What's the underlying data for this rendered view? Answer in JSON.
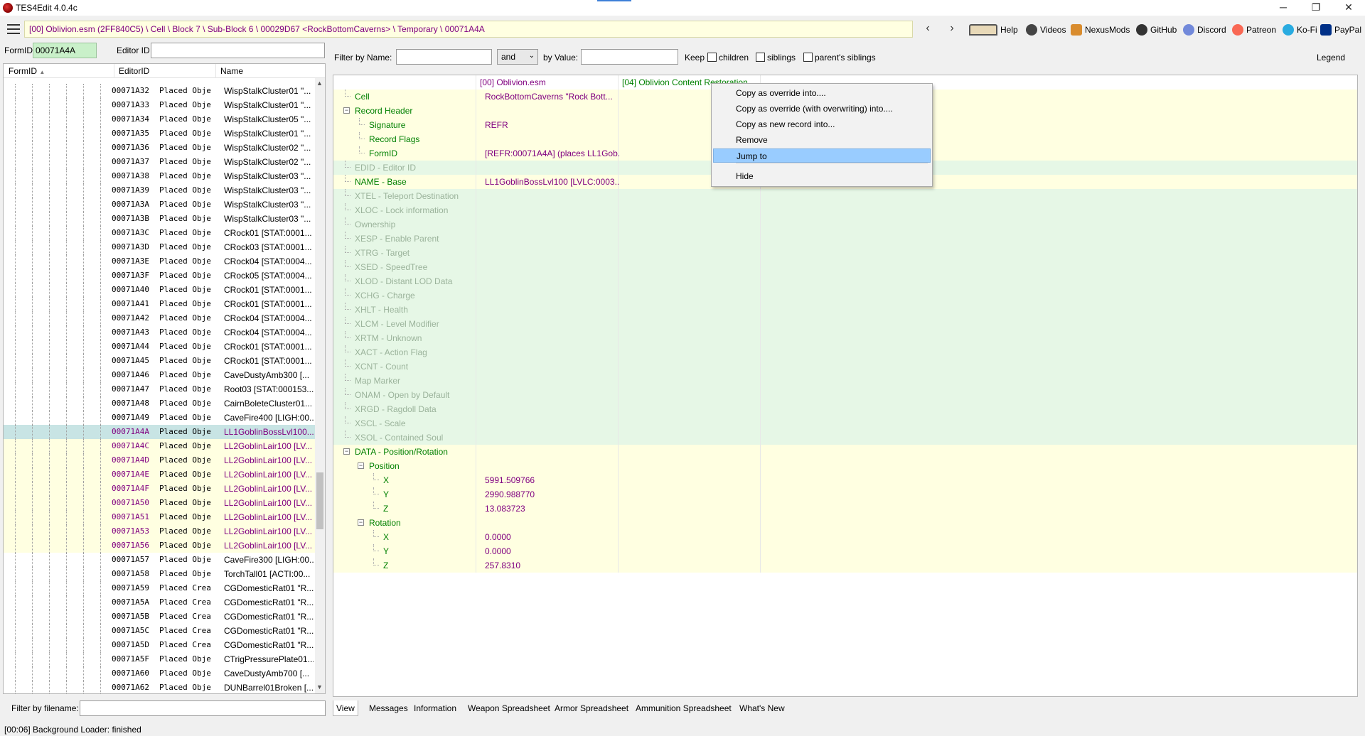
{
  "app": {
    "title": "TES4Edit 4.0.4c"
  },
  "window": {
    "minimize": "─",
    "restore": "❐",
    "close": "✕"
  },
  "toolbar": {
    "path": "[00] Oblivion.esm (2FF840C5) \\ Cell \\ Block 7 \\ Sub-Block 6 \\ 00029D67 <RockBottomCaverns> \\ Temporary \\ 00071A4A",
    "back": "‹",
    "forward": "›",
    "links": [
      "Help",
      "Videos",
      "NexusMods",
      "GitHub",
      "Discord",
      "Patreon",
      "Ko-Fi",
      "PayPal"
    ]
  },
  "left": {
    "formid_label": "FormID",
    "formid_value": "00071A4A",
    "editorid_label": "Editor ID",
    "columns": [
      "FormID",
      "EditorID",
      "Name"
    ],
    "rows": [
      [
        "00071A32",
        "Placed Obje",
        "WispStalkCluster01 \"...",
        "n"
      ],
      [
        "00071A33",
        "Placed Obje",
        "WispStalkCluster01 \"...",
        "n"
      ],
      [
        "00071A34",
        "Placed Obje",
        "WispStalkCluster05 \"...",
        "n"
      ],
      [
        "00071A35",
        "Placed Obje",
        "WispStalkCluster01 \"...",
        "n"
      ],
      [
        "00071A36",
        "Placed Obje",
        "WispStalkCluster02 \"...",
        "n"
      ],
      [
        "00071A37",
        "Placed Obje",
        "WispStalkCluster02 \"...",
        "n"
      ],
      [
        "00071A38",
        "Placed Obje",
        "WispStalkCluster03 \"...",
        "n"
      ],
      [
        "00071A39",
        "Placed Obje",
        "WispStalkCluster03 \"...",
        "n"
      ],
      [
        "00071A3A",
        "Placed Obje",
        "WispStalkCluster03 \"...",
        "n"
      ],
      [
        "00071A3B",
        "Placed Obje",
        "WispStalkCluster03 \"...",
        "n"
      ],
      [
        "00071A3C",
        "Placed Obje",
        "CRock01 [STAT:0001...",
        "n"
      ],
      [
        "00071A3D",
        "Placed Obje",
        "CRock03 [STAT:0001...",
        "n"
      ],
      [
        "00071A3E",
        "Placed Obje",
        "CRock04 [STAT:0004...",
        "n"
      ],
      [
        "00071A3F",
        "Placed Obje",
        "CRock05 [STAT:0004...",
        "n"
      ],
      [
        "00071A40",
        "Placed Obje",
        "CRock01 [STAT:0001...",
        "n"
      ],
      [
        "00071A41",
        "Placed Obje",
        "CRock01 [STAT:0001...",
        "n"
      ],
      [
        "00071A42",
        "Placed Obje",
        "CRock04 [STAT:0004...",
        "n"
      ],
      [
        "00071A43",
        "Placed Obje",
        "CRock04 [STAT:0004...",
        "n"
      ],
      [
        "00071A44",
        "Placed Obje",
        "CRock01 [STAT:0001...",
        "n"
      ],
      [
        "00071A45",
        "Placed Obje",
        "CRock01 [STAT:0001...",
        "n"
      ],
      [
        "00071A46",
        "Placed Obje",
        "CaveDustyAmb300 [...",
        "n"
      ],
      [
        "00071A47",
        "Placed Obje",
        "Root03 [STAT:000153...",
        "n"
      ],
      [
        "00071A48",
        "Placed Obje",
        "CairnBoleteCluster01...",
        "n"
      ],
      [
        "00071A49",
        "Placed Obje",
        "CaveFire400 [LIGH:00...",
        "n"
      ],
      [
        "00071A4A",
        "Placed Obje",
        "LL1GoblinBossLvl100...",
        "s"
      ],
      [
        "00071A4C",
        "Placed Obje",
        "LL2GoblinLair100 [LV...",
        "y"
      ],
      [
        "00071A4D",
        "Placed Obje",
        "LL2GoblinLair100 [LV...",
        "y"
      ],
      [
        "00071A4E",
        "Placed Obje",
        "LL2GoblinLair100 [LV...",
        "y"
      ],
      [
        "00071A4F",
        "Placed Obje",
        "LL2GoblinLair100 [LV...",
        "y"
      ],
      [
        "00071A50",
        "Placed Obje",
        "LL2GoblinLair100 [LV...",
        "y"
      ],
      [
        "00071A51",
        "Placed Obje",
        "LL2GoblinLair100 [LV...",
        "y"
      ],
      [
        "00071A53",
        "Placed Obje",
        "LL2GoblinLair100 [LV...",
        "y"
      ],
      [
        "00071A56",
        "Placed Obje",
        "LL2GoblinLair100 [LV...",
        "y"
      ],
      [
        "00071A57",
        "Placed Obje",
        "CaveFire300 [LIGH:00...",
        "n"
      ],
      [
        "00071A58",
        "Placed Obje",
        "TorchTall01 [ACTI:00...",
        "n"
      ],
      [
        "00071A59",
        "Placed Crea",
        "CGDomesticRat01 \"R...",
        "n"
      ],
      [
        "00071A5A",
        "Placed Crea",
        "CGDomesticRat01 \"R...",
        "n"
      ],
      [
        "00071A5B",
        "Placed Crea",
        "CGDomesticRat01 \"R...",
        "n"
      ],
      [
        "00071A5C",
        "Placed Crea",
        "CGDomesticRat01 \"R...",
        "n"
      ],
      [
        "00071A5D",
        "Placed Crea",
        "CGDomesticRat01 \"R...",
        "n"
      ],
      [
        "00071A5F",
        "Placed Obje",
        "CTrigPressurePlate01...",
        "n"
      ],
      [
        "00071A60",
        "Placed Obje",
        "CaveDustyAmb700 [...",
        "n"
      ],
      [
        "00071A62",
        "Placed Obje",
        "DUNBarrel01Broken [...",
        "n"
      ]
    ],
    "filename_label": "Filter by filename:"
  },
  "filter": {
    "byname_label": "Filter by Name:",
    "and_value": "and",
    "byvalue_label": "by Value:",
    "keep_label": "Keep",
    "children": "children",
    "siblings": "siblings",
    "parents_siblings": "parent's siblings",
    "legend": "Legend"
  },
  "view": {
    "col1": "[00] Oblivion.esm",
    "col2": "[04] Oblivion Content Restoration",
    "rows": [
      [
        "Cell",
        "RockBottomCaverns \"Rock Bott...",
        0,
        "",
        "y"
      ],
      [
        "Record Header",
        "",
        0,
        "-",
        "y"
      ],
      [
        "Signature",
        "REFR",
        1,
        "",
        "y"
      ],
      [
        "Record Flags",
        "",
        1,
        "",
        "y"
      ],
      [
        "FormID",
        "[REFR:00071A4A] (places LL1Gob...",
        1,
        "",
        "y"
      ],
      [
        "EDID - Editor ID",
        "",
        0,
        "",
        "g"
      ],
      [
        "NAME - Base",
        "LL1GoblinBossLvl100 [LVLC:0003...",
        0,
        "",
        "y"
      ],
      [
        "XTEL - Teleport Destination",
        "",
        0,
        "",
        "g"
      ],
      [
        "XLOC - Lock information",
        "",
        0,
        "",
        "g"
      ],
      [
        "Ownership",
        "",
        0,
        "",
        "g"
      ],
      [
        "XESP - Enable Parent",
        "",
        0,
        "",
        "g"
      ],
      [
        "XTRG - Target",
        "",
        0,
        "",
        "g"
      ],
      [
        "XSED - SpeedTree",
        "",
        0,
        "",
        "g"
      ],
      [
        "XLOD - Distant LOD Data",
        "",
        0,
        "",
        "g"
      ],
      [
        "XCHG - Charge",
        "",
        0,
        "",
        "g"
      ],
      [
        "XHLT - Health",
        "",
        0,
        "",
        "g"
      ],
      [
        "XLCM - Level Modifier",
        "",
        0,
        "",
        "g"
      ],
      [
        "XRTM - Unknown",
        "",
        0,
        "",
        "g"
      ],
      [
        "XACT - Action Flag",
        "",
        0,
        "",
        "g"
      ],
      [
        "XCNT - Count",
        "",
        0,
        "",
        "g"
      ],
      [
        "Map Marker",
        "",
        0,
        "",
        "g"
      ],
      [
        "ONAM - Open by Default",
        "",
        0,
        "",
        "g"
      ],
      [
        "XRGD - Ragdoll Data",
        "",
        0,
        "",
        "g"
      ],
      [
        "XSCL - Scale",
        "",
        0,
        "",
        "g"
      ],
      [
        "XSOL - Contained Soul",
        "",
        0,
        "",
        "g"
      ],
      [
        "DATA - Position/Rotation",
        "",
        0,
        "-",
        "y"
      ],
      [
        "Position",
        "",
        1,
        "-",
        "y"
      ],
      [
        "X",
        "5991.509766",
        2,
        "",
        "y"
      ],
      [
        "Y",
        "2990.988770",
        2,
        "",
        "y"
      ],
      [
        "Z",
        "13.083723",
        2,
        "",
        "y"
      ],
      [
        "Rotation",
        "",
        1,
        "-",
        "y"
      ],
      [
        "X",
        "0.0000",
        2,
        "",
        "y"
      ],
      [
        "Y",
        "0.0000",
        2,
        "",
        "y"
      ],
      [
        "Z",
        "257.8310",
        2,
        "",
        "y"
      ]
    ]
  },
  "context_menu": {
    "items": [
      "Copy as override into....",
      "Copy as override (with overwriting) into....",
      "Copy as new record into...",
      "Remove",
      "Jump to",
      "Hide"
    ],
    "highlighted": "Jump to"
  },
  "tabs": [
    "View",
    "Messages",
    "Information",
    "Weapon Spreadsheet",
    "Armor Spreadsheet",
    "Ammunition Spreadsheet",
    "What's New"
  ],
  "status": "[00:06] Background Loader: finished",
  "colors": {
    "selected_row": "#c8e4e4",
    "highlight_yellow": "#ffffe1",
    "menu_highlight": "#99ccff",
    "formid_green": "#c9f0c9"
  }
}
